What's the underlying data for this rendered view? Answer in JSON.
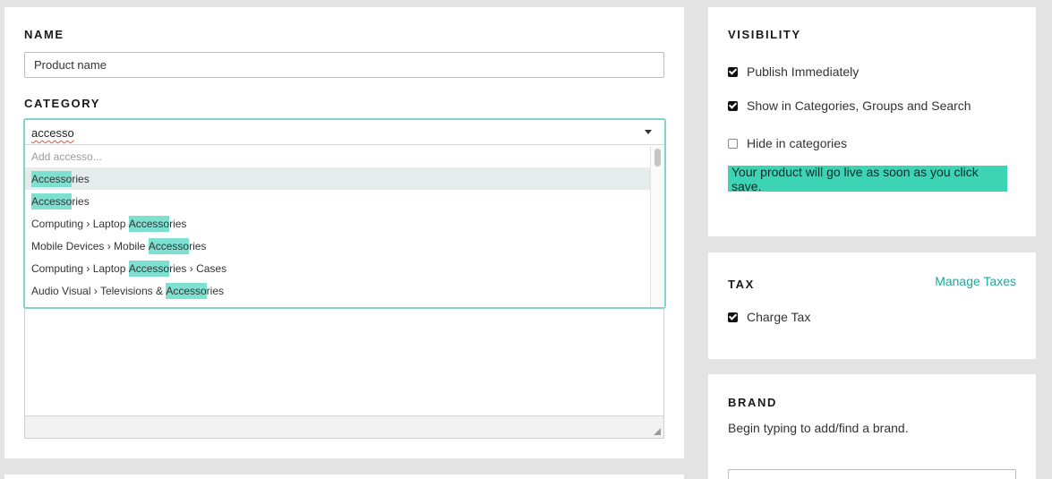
{
  "name_section": {
    "heading": "NAME",
    "input_value": "Product name"
  },
  "category_section": {
    "heading": "CATEGORY",
    "search_value": "accesso",
    "add_option": "Add accesso...",
    "options": [
      {
        "before": "",
        "match": "Accesso",
        "after": "ries"
      },
      {
        "before": "",
        "match": "Accesso",
        "after": "ries"
      },
      {
        "before": "Computing › Laptop ",
        "match": "Accesso",
        "after": "ries"
      },
      {
        "before": "Mobile Devices › Mobile ",
        "match": "Accesso",
        "after": "ries"
      },
      {
        "before": "Computing › Laptop ",
        "match": "Accesso",
        "after": "ries › Cases"
      },
      {
        "before": "Audio Visual › Televisions & ",
        "match": "Accesso",
        "after": "ries"
      }
    ]
  },
  "visibility": {
    "heading": "VISIBILITY",
    "publish_label": "Publish Immediately",
    "show_label": "Show in Categories, Groups and Search",
    "hide_label": "Hide in categories",
    "notice": "Your product will go live as soon as you click save."
  },
  "tax": {
    "heading": "TAX",
    "manage_link": "Manage Taxes",
    "charge_label": "Charge Tax"
  },
  "brand": {
    "heading": "BRAND",
    "helper": "Begin typing to add/find a brand."
  },
  "colors": {
    "accent": "#3dd4b6",
    "highlight": "#7ee0d0",
    "link": "#1aa99a",
    "focus_border": "#7fd6c6"
  }
}
